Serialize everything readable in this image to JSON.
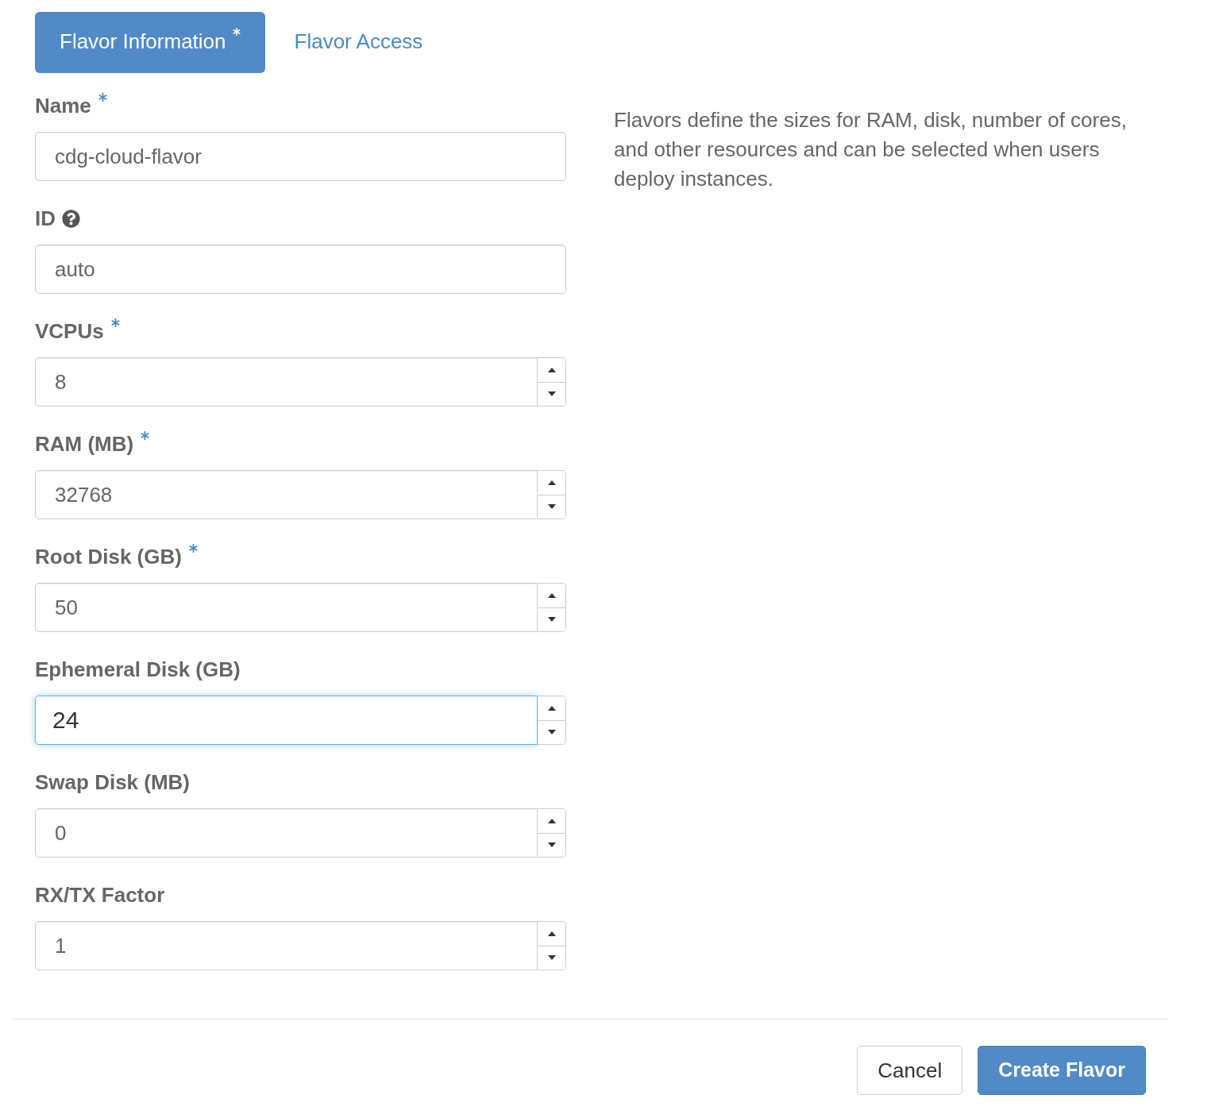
{
  "tabs": [
    {
      "label": "Flavor Information",
      "required": true,
      "selected": true
    },
    {
      "label": "Flavor Access",
      "required": false,
      "selected": false
    }
  ],
  "fields": [
    {
      "label": "Name",
      "required": true,
      "help": false,
      "kind": "text",
      "value": "cdg-cloud-flavor",
      "focused": false
    },
    {
      "label": "ID",
      "required": false,
      "help": true,
      "kind": "text",
      "value": "auto",
      "focused": false
    },
    {
      "label": "VCPUs",
      "required": true,
      "help": false,
      "kind": "number",
      "value": "8",
      "focused": false
    },
    {
      "label": "RAM (MB)",
      "required": true,
      "help": false,
      "kind": "number",
      "value": "32768",
      "focused": false
    },
    {
      "label": "Root Disk (GB)",
      "required": true,
      "help": false,
      "kind": "number",
      "value": "50",
      "focused": false
    },
    {
      "label": "Ephemeral Disk (GB)",
      "required": false,
      "help": false,
      "kind": "number",
      "value": "24",
      "focused": true
    },
    {
      "label": "Swap Disk (MB)",
      "required": false,
      "help": false,
      "kind": "number",
      "value": "0",
      "focused": false
    },
    {
      "label": "RX/TX Factor",
      "required": false,
      "help": false,
      "kind": "number",
      "value": "1",
      "focused": false
    }
  ],
  "description": "Flavors define the sizes for RAM, disk, number of cores, and other resources and can be selected when users deploy instances.",
  "buttons": [
    {
      "label": "Cancel",
      "kind": "default"
    },
    {
      "label": "Create Flavor",
      "kind": "primary"
    }
  ]
}
